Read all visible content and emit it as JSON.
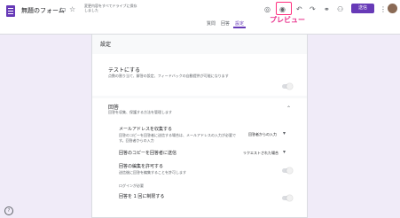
{
  "header": {
    "title": "無題のフォーム",
    "save_status": "変更内容をすべてドライブに保存しました",
    "send_label": "送信",
    "preview_annotation": "プレビュー"
  },
  "tabs": [
    {
      "label": "質問"
    },
    {
      "label": "回答"
    },
    {
      "label": "設定"
    }
  ],
  "settings": {
    "title": "設定",
    "quiz": {
      "label": "テストにする",
      "desc": "点数の割り当て、解答の設定、フィードバックの自動提供が可能になります"
    },
    "responses": {
      "label": "回答",
      "desc": "回答を収集、保護する方法を管理します",
      "email": {
        "label": "メールアドレスを収集する",
        "desc": "回答のコピーを回答者に送信する場合は、メールアドレスの入力が必要です。回答者からの入力",
        "value": "回答者からの入力"
      },
      "copy": {
        "label": "回答のコピーを回答者に送信",
        "value": "リクエストされた場合"
      },
      "edit": {
        "label": "回答の編集を許可する",
        "desc": "送信後に回答を編集することを許可します"
      },
      "login_label": "ログインが必要",
      "limit": {
        "label": "回答を 1 回に制限する"
      }
    }
  },
  "icons": [
    "folder-icon",
    "star-icon",
    "palette-icon",
    "eye-icon",
    "undo-icon",
    "redo-icon",
    "link-icon",
    "more-icon",
    "avatar",
    "help-icon"
  ]
}
